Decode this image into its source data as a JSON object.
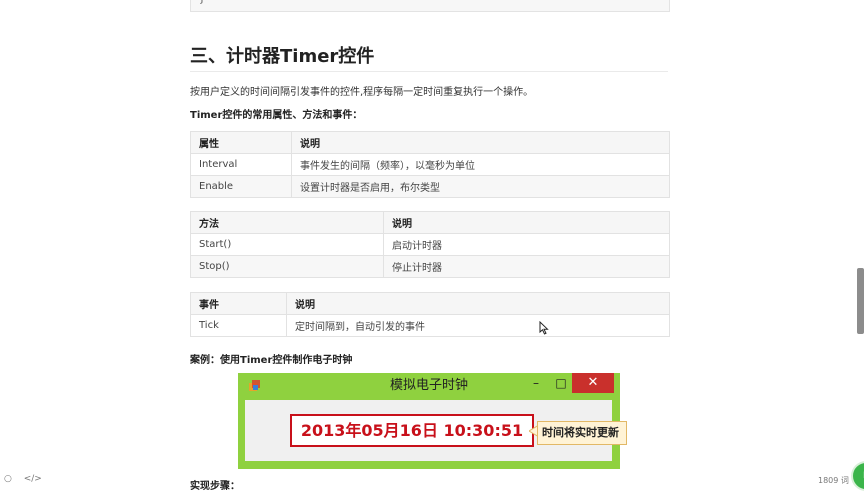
{
  "code_tail": "}",
  "heading": "三、计时器Timer控件",
  "intro": "按用户定义的时间间隔引发事件的控件,程序每隔一定时间重复执行一个操作。",
  "subheading": "Timer控件的常用属性、方法和事件：",
  "properties_table": {
    "headers": [
      "属性",
      "说明"
    ],
    "rows": [
      [
        "Interval",
        "事件发生的间隔（频率），以毫秒为单位"
      ],
      [
        "Enable",
        "设置计时器是否启用，布尔类型"
      ]
    ]
  },
  "methods_table": {
    "headers": [
      "方法",
      "说明"
    ],
    "rows": [
      [
        "Start()",
        "启动计时器"
      ],
      [
        "Stop()",
        "停止计时器"
      ]
    ]
  },
  "events_table": {
    "headers": [
      "事件",
      "说明"
    ],
    "rows": [
      [
        "Tick",
        "定时间隔到，自动引发的事件"
      ]
    ]
  },
  "example_label": "案例：使用Timer控件制作电子时钟",
  "app_window": {
    "title": "模拟电子时钟",
    "clock_text": "2013年05月16日  10:30:51",
    "callout": "时间将实时更新",
    "minimize": "–",
    "maximize": "□",
    "close": "✕"
  },
  "next_section": "实现步骤：",
  "word_count": "1809 词",
  "fab_label": "K",
  "colors": {
    "window_frame": "#8fd13f",
    "clock_red": "#c8101a",
    "close_button": "#c9302c"
  }
}
